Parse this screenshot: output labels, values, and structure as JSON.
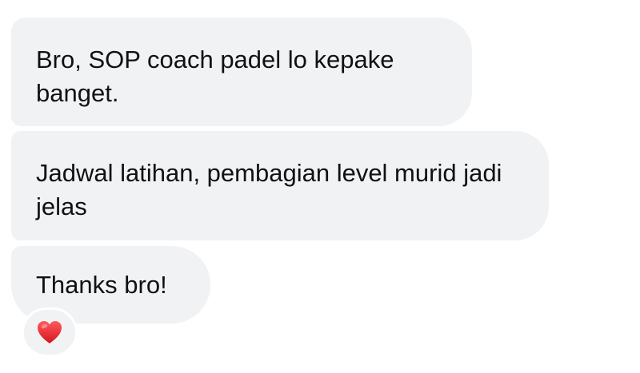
{
  "messages": [
    {
      "text": "Bro, SOP coach padel lo kepake banget."
    },
    {
      "text": "Jadwal latihan, pembagian level murid jadi jelas"
    },
    {
      "text": "Thanks bro!"
    }
  ],
  "reaction": {
    "icon": "red-heart-icon",
    "color": "#e1242b"
  }
}
